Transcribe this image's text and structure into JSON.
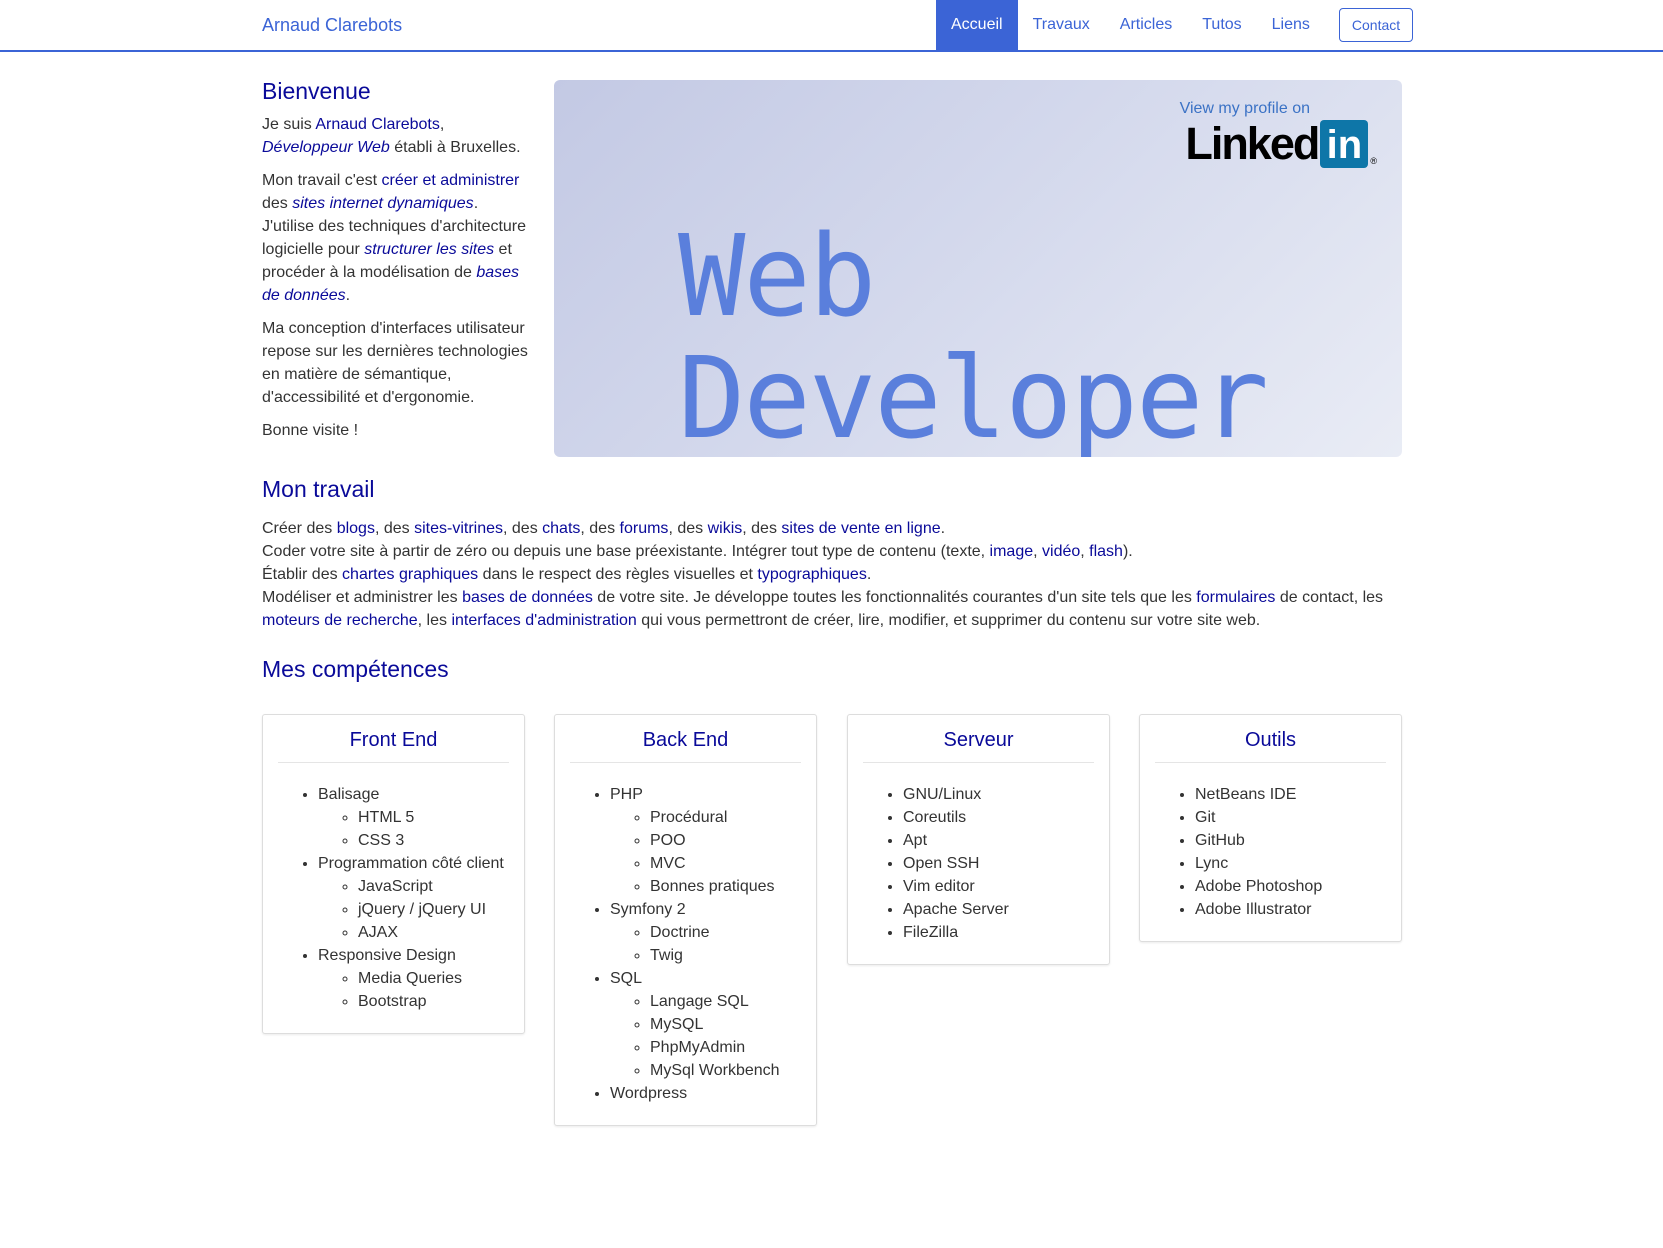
{
  "nav": {
    "brand": "Arnaud Clarebots",
    "items": [
      "Accueil",
      "Travaux",
      "Articles",
      "Tutos",
      "Liens"
    ],
    "contact": "Contact"
  },
  "intro": {
    "title": "Bienvenue",
    "p1": {
      "t1": "Je suis ",
      "name": "Arnaud Clarebots",
      "t2": ",",
      "role": "Développeur Web",
      "t3": " établi à Bruxelles."
    },
    "p2": {
      "t1": "Mon travail c'est ",
      "l1": "créer et administrer",
      "t2": " des ",
      "l2": "sites internet dynamiques",
      "t3": ". J'utilise des techniques d'architecture logicielle pour ",
      "l3": "structurer les sites",
      "t4": " et procéder à la modélisation de ",
      "l4": "bases de données",
      "t5": "."
    },
    "p3": "Ma conception d'interfaces utilisateur repose sur les dernières technologies en matière de sémantique, d'accessibilité et d'ergonomie.",
    "p4": "Bonne visite !"
  },
  "hero": {
    "line1": "Web",
    "line2": "Developer",
    "linkedin_caption": "View my profile on",
    "linkedin_word": "Linked",
    "linkedin_in": "in",
    "linkedin_reg": "®"
  },
  "work": {
    "title": "Mon travail",
    "line1": {
      "t0": "Créer des ",
      "l1": "blogs",
      "t1": ", des ",
      "l2": "sites-vitrines",
      "t2": ", des ",
      "l3": "chats",
      "t3": ", des ",
      "l4": "forums",
      "t4": ", des ",
      "l5": "wikis",
      "t5": ", des ",
      "l6": "sites de vente en ligne",
      "t6": "."
    },
    "line2": {
      "t0": "Coder votre site à partir de zéro ou depuis une base préexistante. Intégrer tout type de contenu (texte, ",
      "l1": "image",
      "t1": ", ",
      "l2": "vidéo",
      "t2": ", ",
      "l3": "flash",
      "t3": ")."
    },
    "line3": {
      "t0": "Établir des ",
      "l1": "chartes graphiques",
      "t1": " dans le respect des règles visuelles et ",
      "l2": "typographiques",
      "t2": "."
    },
    "line4": {
      "t0": "Modéliser et administrer les ",
      "l1": "bases de données",
      "t1": " de votre site. Je développe toutes les fonctionnalités courantes d'un site tels que les ",
      "l2": "formulaires",
      "t2": " de contact, les ",
      "l3": "moteurs de recherche",
      "t3": ", les ",
      "l4": "interfaces d'administration",
      "t4": " qui vous permettront de créer, lire, modifier, et supprimer du contenu sur votre site web."
    }
  },
  "skills": {
    "title": "Mes compétences",
    "front": {
      "title": "Front End",
      "g1": "Balisage",
      "g1_items": [
        "HTML 5",
        "CSS 3"
      ],
      "g2": "Programmation côté client",
      "g2_items": [
        "JavaScript",
        "jQuery / jQuery UI",
        "AJAX"
      ],
      "g3": "Responsive Design",
      "g3_items": [
        "Media Queries",
        "Bootstrap"
      ]
    },
    "back": {
      "title": "Back End",
      "g1": "PHP",
      "g1_items": [
        "Procédural",
        "POO",
        "MVC",
        "Bonnes pratiques"
      ],
      "g2": "Symfony 2",
      "g2_items": [
        "Doctrine",
        "Twig"
      ],
      "g3": "SQL",
      "g3_items": [
        "Langage SQL",
        "MySQL",
        "PhpMyAdmin",
        "MySql Workbench"
      ],
      "g4": "Wordpress"
    },
    "server": {
      "title": "Serveur",
      "items": [
        "GNU/Linux",
        "Coreutils",
        "Apt",
        "Open SSH",
        "Vim editor",
        "Apache Server",
        "FileZilla"
      ]
    },
    "tools": {
      "title": "Outils",
      "items": [
        "NetBeans IDE",
        "Git",
        "GitHub",
        "Lync",
        "Adobe Photoshop",
        "Adobe Illustrator"
      ]
    }
  },
  "colors": {
    "accent": "#3b64d6",
    "heading": "#0a0a99",
    "linkedin": "#0e76a8"
  }
}
